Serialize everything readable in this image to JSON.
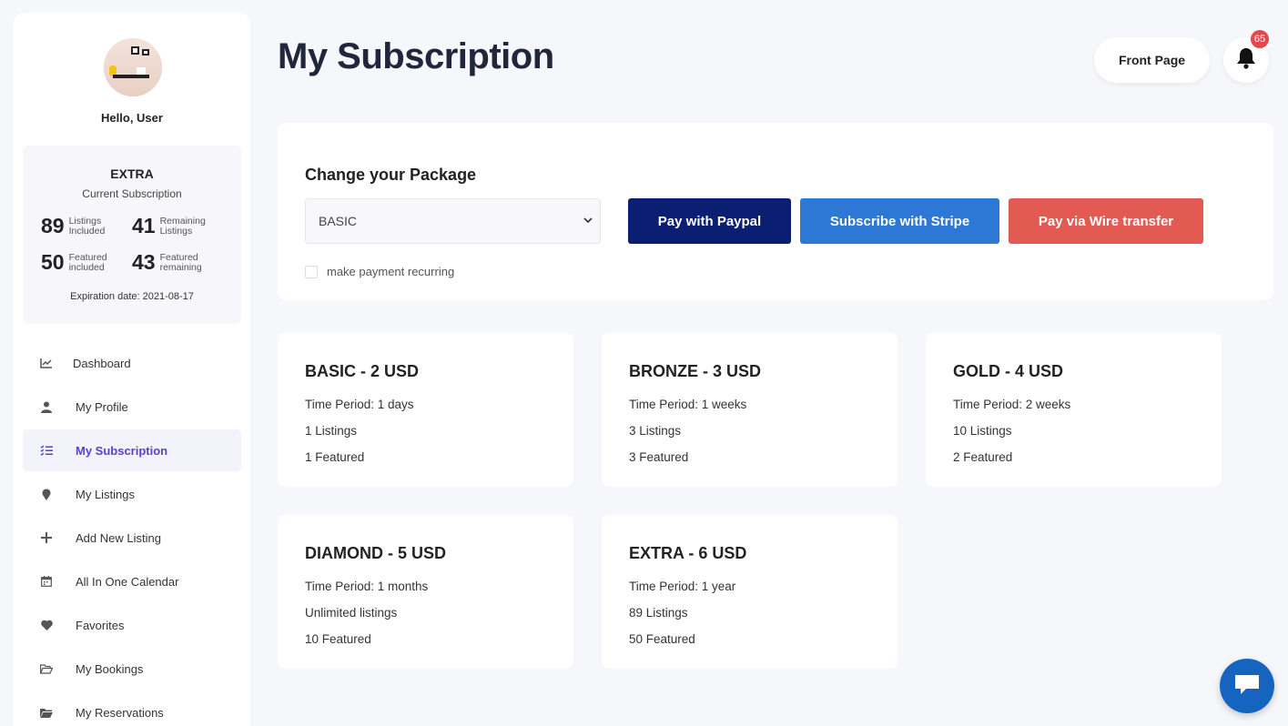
{
  "user": {
    "greeting": "Hello, User"
  },
  "subscription": {
    "plan": "EXTRA",
    "caption": "Current Subscription",
    "stats": [
      {
        "value": "89",
        "label": "Listings Included"
      },
      {
        "value": "41",
        "label": "Remaining Listings"
      },
      {
        "value": "50",
        "label": "Featured included"
      },
      {
        "value": "43",
        "label": "Featured remaining"
      }
    ],
    "expiration": "Expiration date: 2021-08-17"
  },
  "nav": [
    {
      "label": "Dashboard",
      "icon": "chart-icon"
    },
    {
      "label": "My Profile",
      "icon": "user-icon"
    },
    {
      "label": "My Subscription",
      "icon": "list-check-icon",
      "active": true
    },
    {
      "label": "My Listings",
      "icon": "map-pin-icon"
    },
    {
      "label": "Add New Listing",
      "icon": "plus-icon"
    },
    {
      "label": "All In One Calendar",
      "icon": "calendar-icon"
    },
    {
      "label": "Favorites",
      "icon": "heart-icon"
    },
    {
      "label": "My Bookings",
      "icon": "folder-open-icon"
    },
    {
      "label": "My Reservations",
      "icon": "folder-icon"
    }
  ],
  "header": {
    "title": "My Subscription",
    "front_page": "Front Page",
    "notification_count": "65"
  },
  "package_panel": {
    "heading": "Change your Package",
    "select_value": "BASIC",
    "paypal": "Pay with Paypal",
    "stripe": "Subscribe with Stripe",
    "wire": "Pay via Wire transfer",
    "recurring_label": "make payment recurring"
  },
  "packages": [
    {
      "title": "BASIC - 2 USD",
      "period": "Time Period: 1 days",
      "listings": "1 Listings",
      "featured": "1 Featured"
    },
    {
      "title": "BRONZE - 3 USD",
      "period": "Time Period: 1 weeks",
      "listings": "3 Listings",
      "featured": "3 Featured"
    },
    {
      "title": "GOLD - 4 USD",
      "period": "Time Period: 2 weeks",
      "listings": "10 Listings",
      "featured": "2 Featured"
    },
    {
      "title": "DIAMOND - 5 USD",
      "period": "Time Period: 1 months",
      "listings": "Unlimited listings",
      "featured": "10 Featured"
    },
    {
      "title": "EXTRA - 6 USD",
      "period": "Time Period: 1 year",
      "listings": "89 Listings",
      "featured": "50 Featured"
    }
  ],
  "colors": {
    "paypal": "#0b1f72",
    "stripe": "#2d78d4",
    "wire": "#e35a52",
    "accent": "#5b3fd0",
    "badge": "#e04a4a",
    "chat": "#1565c0"
  }
}
